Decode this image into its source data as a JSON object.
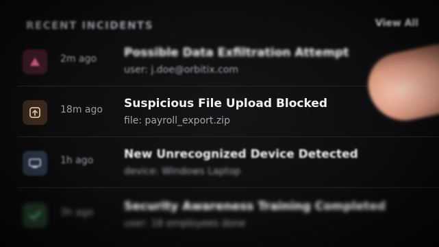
{
  "header": {
    "title": "RECENT INCIDENTS",
    "view_all": "View All"
  },
  "incidents": [
    {
      "icon": "warning-triangle-icon",
      "icon_bg": "#3a1a24",
      "icon_color": "#d9607e",
      "time": "2m ago",
      "title": "Possible Data Exfiltration Attempt",
      "detail": "user: j.doe@orbitix.com"
    },
    {
      "icon": "upload-icon",
      "icon_bg": "#3a2a1c",
      "icon_color": "#e8c9a8",
      "time": "18m ago",
      "title": "Suspicious File Upload Blocked",
      "detail": "file: payroll_export.zip"
    },
    {
      "icon": "device-icon",
      "icon_bg": "#2a3644",
      "icon_color": "#c9d4e2",
      "time": "1h ago",
      "title": "New Unrecognized Device Detected",
      "detail": "device: Windows Laptop"
    },
    {
      "icon": "check-icon",
      "icon_bg": "#1f3a26",
      "icon_color": "#6fd27f",
      "time": "3h ago",
      "title": "Security Awareness Training Completed",
      "detail": "user: 18 employees done"
    }
  ]
}
